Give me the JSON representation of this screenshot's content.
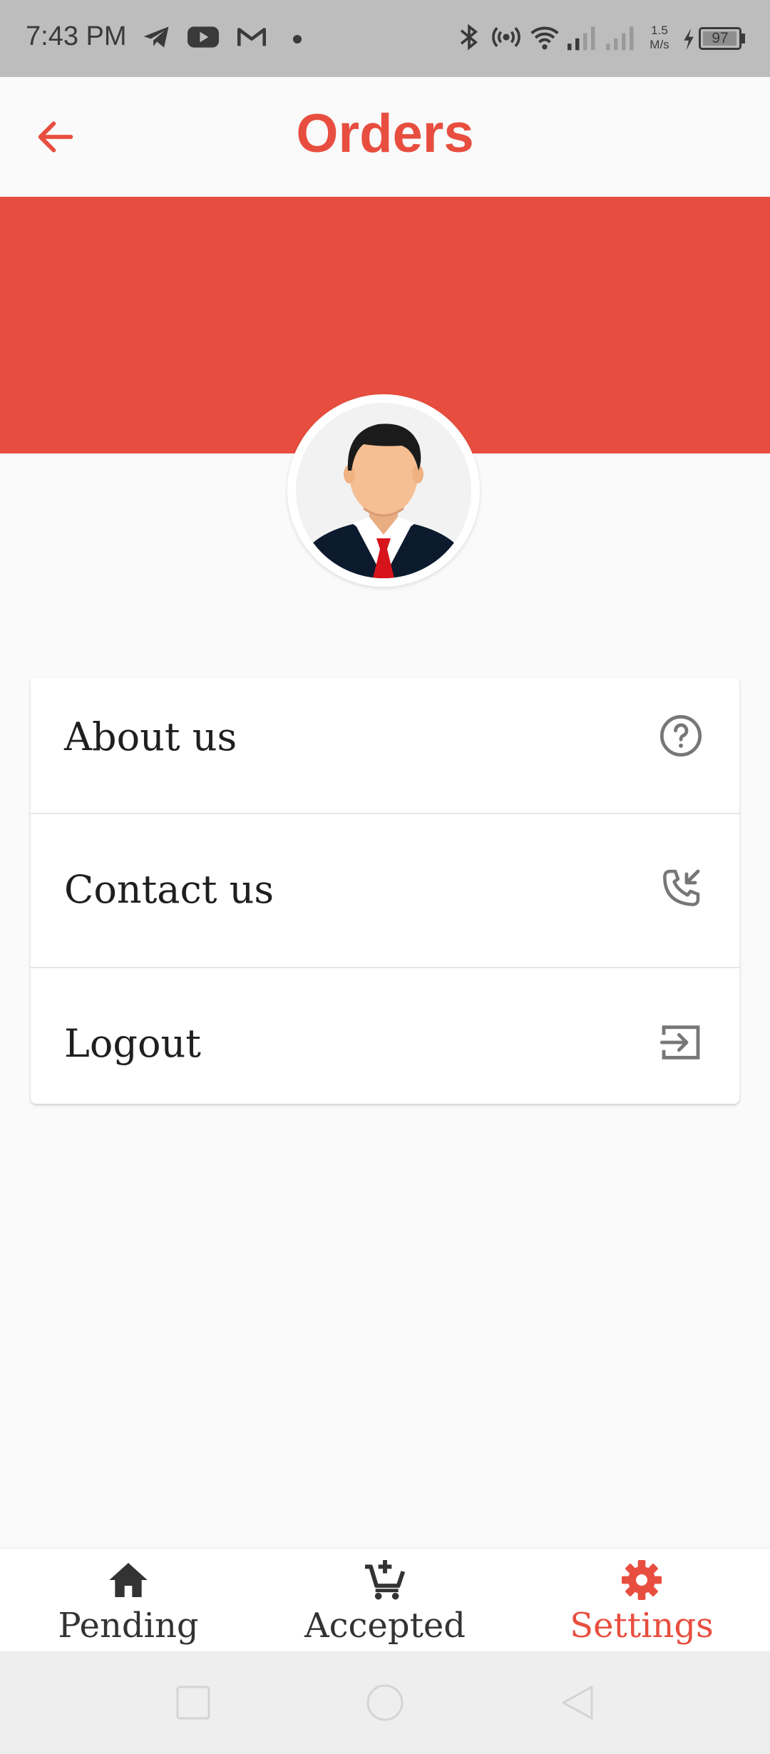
{
  "status_bar": {
    "time": "7:43 PM",
    "notification_icons": [
      "telegram-icon",
      "youtube-icon",
      "gmail-icon"
    ],
    "system_icons": [
      "bluetooth-icon",
      "hotspot-icon",
      "wifi-icon",
      "signal-icon",
      "signal-icon"
    ],
    "net_speed_value": "1.5",
    "net_speed_unit": "M/s",
    "battery_level": "97",
    "battery_charging": true
  },
  "app_bar": {
    "title": "Orders",
    "back_icon": "arrow-left-icon"
  },
  "theme": {
    "accent": "#e84e3f",
    "background": "#fafafa",
    "text": "#1f1f1f",
    "icon_gray": "#777777"
  },
  "profile": {
    "avatar": "businessman-avatar"
  },
  "menu": {
    "items": [
      {
        "label": "About us",
        "icon": "help-circle-icon"
      },
      {
        "label": "Contact us",
        "icon": "phone-incoming-icon"
      },
      {
        "label": "Logout",
        "icon": "logout-icon"
      }
    ]
  },
  "bottom_nav": {
    "items": [
      {
        "label": "Pending",
        "icon": "home-icon",
        "active": false
      },
      {
        "label": "Accepted",
        "icon": "cart-add-icon",
        "active": false
      },
      {
        "label": "Settings",
        "icon": "gear-icon",
        "active": true
      }
    ]
  },
  "system_nav": [
    "recents-square-icon",
    "home-circle-icon",
    "back-triangle-icon"
  ]
}
